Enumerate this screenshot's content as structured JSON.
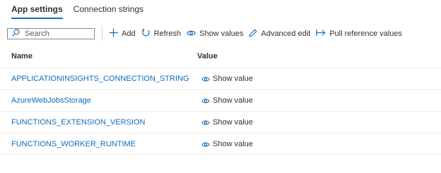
{
  "tabs": [
    {
      "label": "App settings",
      "active": true
    },
    {
      "label": "Connection strings",
      "active": false
    }
  ],
  "toolbar": {
    "search_placeholder": "Search",
    "add_label": "Add",
    "refresh_label": "Refresh",
    "show_values_label": "Show values",
    "advanced_edit_label": "Advanced edit",
    "pull_reference_label": "Pull reference values"
  },
  "table": {
    "columns": [
      "Name",
      "Value"
    ],
    "rows": [
      {
        "name": "APPLICATIONINSIGHTS_CONNECTION_STRING",
        "value": "Show value"
      },
      {
        "name": "AzureWebJobsStorage",
        "value": "Show value"
      },
      {
        "name": "FUNCTIONS_EXTENSION_VERSION",
        "value": "Show value"
      },
      {
        "name": "FUNCTIONS_WORKER_RUNTIME",
        "value": "Show value"
      }
    ]
  },
  "colors": {
    "accent": "#0f6cbd",
    "text": "#323130",
    "border": "#edebe9"
  }
}
